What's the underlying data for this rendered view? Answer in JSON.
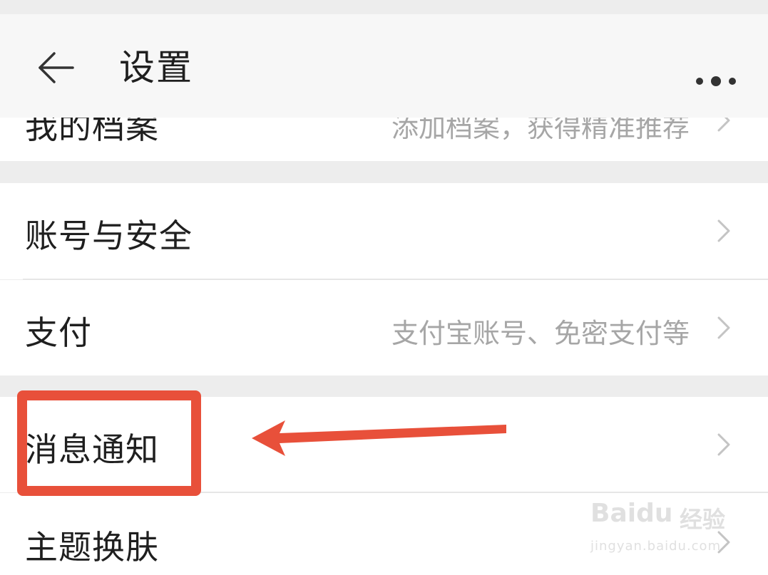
{
  "header": {
    "title": "设置",
    "back_icon": "arrow-left-icon",
    "more_icon": "more-dots-icon"
  },
  "rows": {
    "profile": {
      "label": "我的档案",
      "value": "添加档案，获得精准推荐"
    },
    "account": {
      "label": "账号与安全",
      "value": ""
    },
    "payment": {
      "label": "支付",
      "value": "支付宝账号、免密支付等"
    },
    "notifications": {
      "label": "消息通知",
      "value": ""
    },
    "theme": {
      "label": "主题换肤",
      "value": ""
    }
  },
  "annotation": {
    "color": "#e8503a"
  },
  "watermark": {
    "brand": "Baidu",
    "brand_cn": "经验",
    "url": "jingyan.baidu.com"
  },
  "colors": {
    "background": "#ededed",
    "row_background": "#ffffff",
    "header_background": "#f7f7f7",
    "text_primary": "#1f1f1f",
    "text_secondary": "#a6a6a6"
  }
}
